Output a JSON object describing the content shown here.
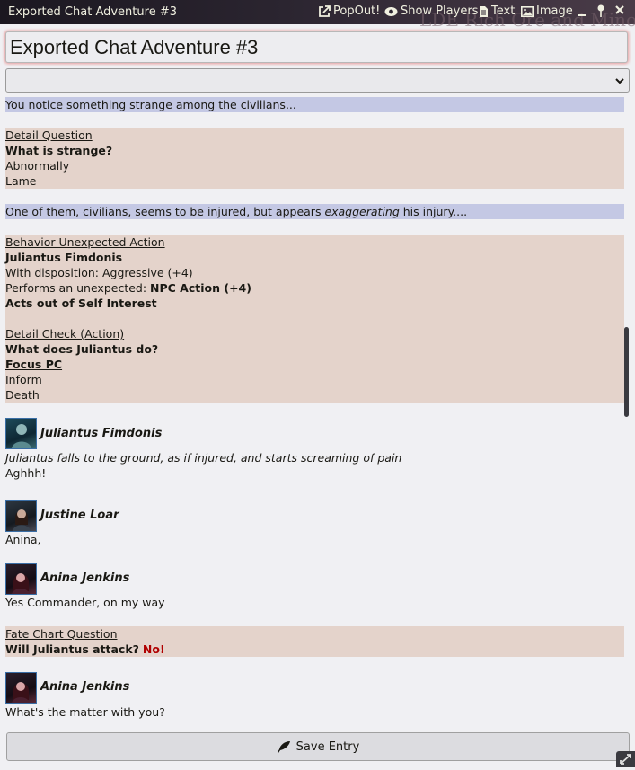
{
  "window": {
    "title": "Exported Chat Adventure #3",
    "background_text": "LDE Rich Ore and Minor",
    "controls": {
      "popout": "PopOut!",
      "show_players": "Show Players",
      "text": "Text",
      "image": "Image"
    }
  },
  "entry": {
    "title_value": "Exported Chat Adventure #3",
    "select_value": ""
  },
  "log": {
    "b1": "You notice something strange among the civilians...",
    "b2": {
      "heading": "Detail Question",
      "question": "What is strange?",
      "r1": "Abnormally",
      "r2": "Lame"
    },
    "b3": {
      "pre": "One of them, civilians, seems to be injured, but appears ",
      "em": "exaggerating",
      "post": " his injury...."
    },
    "b4": {
      "heading": "Behavior Unexpected Action",
      "npc": "Juliantus Fimdonis",
      "disposition": "With disposition: Aggressive (+4)",
      "performs_prefix": "Performs an unexpected: ",
      "performs_action": "NPC Action (+4)",
      "acts": "Acts out of Self Interest",
      "check_heading": "Detail Check (Action)",
      "check_question": "What does Juliantus do?",
      "focus": "Focus PC",
      "r1": "Inform",
      "r2": "Death"
    },
    "m1": {
      "speaker": "Juliantus Fimdonis",
      "l1": "Juliantus falls to the ground, as if injured, and starts screaming of pain",
      "l2": "Aghhh!"
    },
    "m2": {
      "speaker": "Justine Loar",
      "l1": "Anina,"
    },
    "m3": {
      "speaker": "Anina Jenkins",
      "l1": "Yes Commander, on my way"
    },
    "b5": {
      "heading": "Fate Chart Question",
      "question": "Will Juliantus attack?",
      "answer": "No!"
    },
    "m4": {
      "speaker": "Anina Jenkins",
      "l1": "What's the matter with you?"
    }
  },
  "save_label": "Save Entry",
  "colors": {
    "blue_block": "#c4c8e4",
    "tan_block": "#e4d3cb",
    "answer_red": "#b00000"
  }
}
